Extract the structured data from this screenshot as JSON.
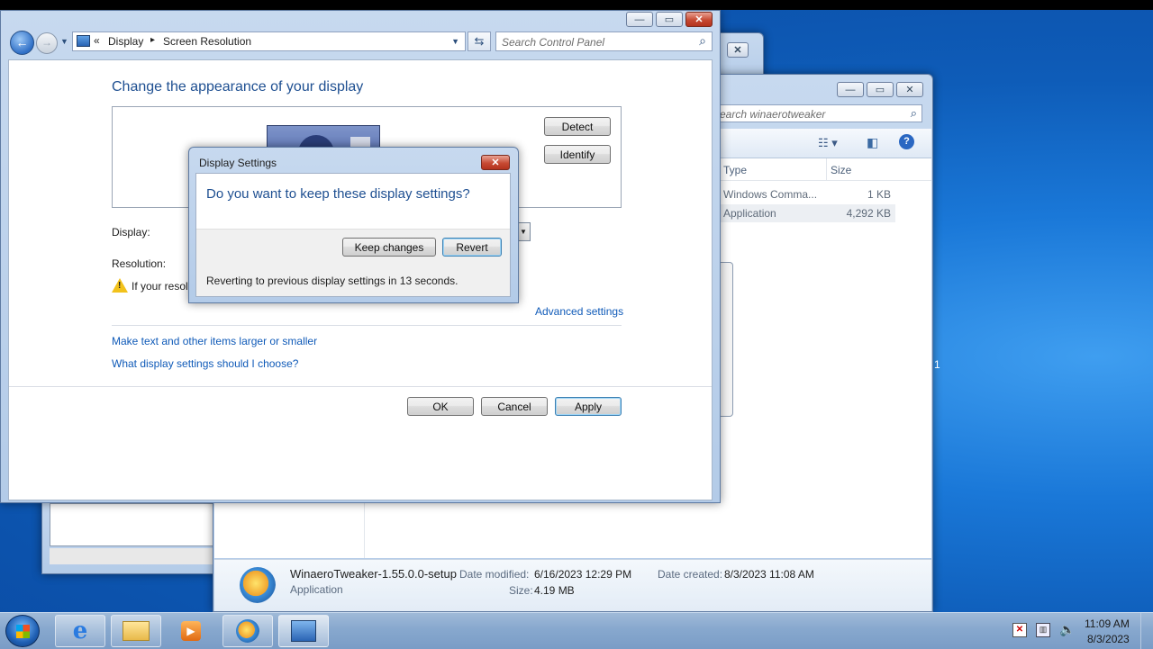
{
  "display_window": {
    "breadcrumb": {
      "chevrons": "«",
      "item1": "Display",
      "separator": "▸",
      "item2": "Screen Resolution"
    },
    "search_placeholder": "Search Control Panel",
    "heading": "Change the appearance of your display",
    "detect_label": "Detect",
    "identify_label": "Identify",
    "display_label": "Display:",
    "resolution_label": "Resolution:",
    "warning_text": "If your resolu",
    "advanced_link": "Advanced settings",
    "link_text_size": "Make text and other items larger or smaller",
    "link_help": "What display settings should I choose?",
    "ok_label": "OK",
    "cancel_label": "Cancel",
    "apply_label": "Apply"
  },
  "dialog": {
    "title": "Display Settings",
    "question": "Do you want to keep these display settings?",
    "keep_label": "Keep changes",
    "revert_label": "Revert",
    "countdown": "Reverting to previous display settings in 13 seconds."
  },
  "explorer": {
    "search_placeholder": "earch winaerotweaker",
    "col_type": "Type",
    "col_size": "Size",
    "rows": [
      {
        "type": "Windows Comma...",
        "size": "1 KB"
      },
      {
        "type": "Application",
        "size": "4,292 KB"
      }
    ],
    "details": {
      "name": "WinaeroTweaker-1.55.0.0-setup",
      "kind": "Application",
      "modified_label": "Date modified:",
      "modified": "6/16/2023 12:29 PM",
      "created_label": "Date created:",
      "created": "8/3/2023 11:08 AM",
      "size_label": "Size:",
      "size": "4.19 MB"
    }
  },
  "desktop_fragment": "1",
  "taskbar": {
    "items": [
      "internet-explorer",
      "file-explorer",
      "media-player",
      "winaero-tweaker",
      "control-panel"
    ],
    "time": "11:09 AM",
    "date": "8/3/2023"
  }
}
